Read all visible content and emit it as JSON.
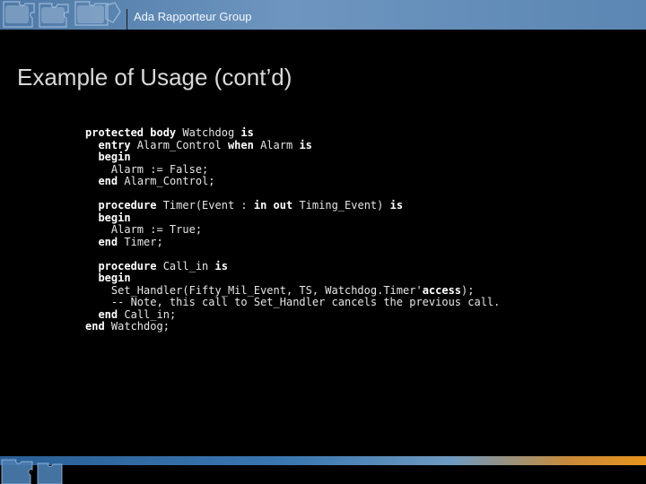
{
  "header": {
    "group_name": "Ada Rapporteur Group"
  },
  "slide": {
    "title": "Example of Usage (cont’d)"
  },
  "code_lines": [
    [
      {
        "t": "protected body",
        "k": true
      },
      {
        "t": " Watchdog ",
        "k": false
      },
      {
        "t": "is",
        "k": true
      }
    ],
    [
      {
        "t": "  ",
        "k": false
      },
      {
        "t": "entry",
        "k": true
      },
      {
        "t": " Alarm_Control ",
        "k": false
      },
      {
        "t": "when",
        "k": true
      },
      {
        "t": " Alarm ",
        "k": false
      },
      {
        "t": "is",
        "k": true
      }
    ],
    [
      {
        "t": "  ",
        "k": false
      },
      {
        "t": "begin",
        "k": true
      }
    ],
    [
      {
        "t": "    Alarm := False;",
        "k": false
      }
    ],
    [
      {
        "t": "  ",
        "k": false
      },
      {
        "t": "end",
        "k": true
      },
      {
        "t": " Alarm_Control;",
        "k": false
      }
    ],
    [],
    [
      {
        "t": "  ",
        "k": false
      },
      {
        "t": "procedure",
        "k": true
      },
      {
        "t": " Timer(Event : ",
        "k": false
      },
      {
        "t": "in out",
        "k": true
      },
      {
        "t": " Timing_Event) ",
        "k": false
      },
      {
        "t": "is",
        "k": true
      }
    ],
    [
      {
        "t": "  ",
        "k": false
      },
      {
        "t": "begin",
        "k": true
      }
    ],
    [
      {
        "t": "    Alarm := True;",
        "k": false
      }
    ],
    [
      {
        "t": "  ",
        "k": false
      },
      {
        "t": "end",
        "k": true
      },
      {
        "t": " Timer;",
        "k": false
      }
    ],
    [],
    [
      {
        "t": "  ",
        "k": false
      },
      {
        "t": "procedure",
        "k": true
      },
      {
        "t": " Call_in ",
        "k": false
      },
      {
        "t": "is",
        "k": true
      }
    ],
    [
      {
        "t": "  ",
        "k": false
      },
      {
        "t": "begin",
        "k": true
      }
    ],
    [
      {
        "t": "    Set_Handler(Fifty_Mil_Event, TS, Watchdog.Timer'",
        "k": false
      },
      {
        "t": "access",
        "k": true
      },
      {
        "t": ");",
        "k": false
      }
    ],
    [
      {
        "t": "    -- Note, this call to Set_Handler cancels the previous call.",
        "k": false
      }
    ],
    [
      {
        "t": "  ",
        "k": false
      },
      {
        "t": "end",
        "k": true
      },
      {
        "t": " Call_in;",
        "k": false
      }
    ],
    [
      {
        "t": "end",
        "k": true
      },
      {
        "t": " Watchdog;",
        "k": false
      }
    ]
  ],
  "colors": {
    "background": "#000000",
    "header_band": "#5f89b5",
    "title_text": "#d9d9d9",
    "code_text": "#e6e6e6"
  },
  "icons": {
    "header_art": "puzzle-pieces-icon",
    "footer_art": "puzzle-pieces-icon"
  }
}
